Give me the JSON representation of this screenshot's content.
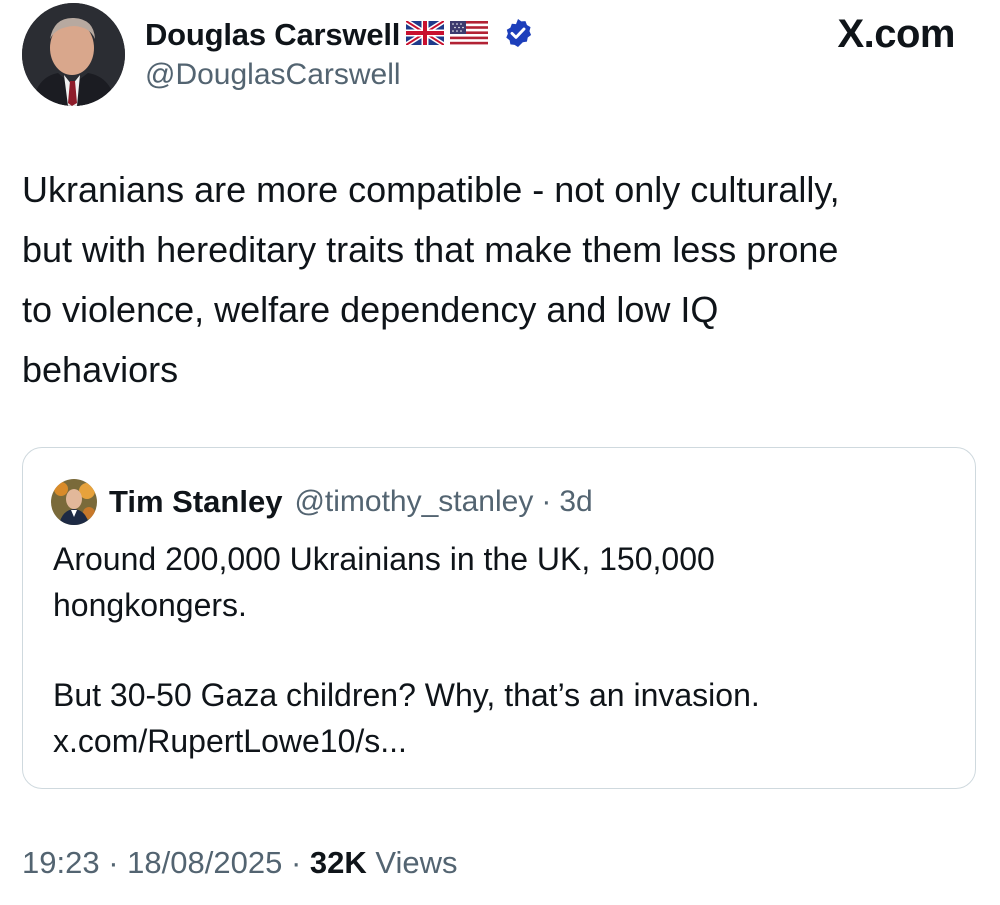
{
  "author": {
    "name": "Douglas Carswell",
    "handle": "@DouglasCarswell",
    "flags": [
      "uk-flag-icon",
      "us-flag-icon"
    ],
    "verified": true
  },
  "brand": "X.com",
  "tweet": {
    "lines": [
      "Ukranians are more compatible - not only culturally,",
      "but with hereditary traits that make them less prone",
      "to violence, welfare dependency and low IQ",
      "behaviors"
    ]
  },
  "quote": {
    "name": "Tim Stanley",
    "handle": "@timothy_stanley",
    "separator": "·",
    "time": "3d",
    "paragraph1": [
      "Around 200,000 Ukrainians in the UK, 150,000",
      "hongkongers."
    ],
    "paragraph2": [
      "But 30-50 Gaza children? Why, that’s an invasion.",
      "x.com/RupertLowe10/s..."
    ]
  },
  "meta": {
    "time": "19:23",
    "sep1": "·",
    "date": "18/08/2025",
    "sep2": "·",
    "views_count": "32K",
    "views_label": "Views"
  },
  "colors": {
    "text": "#0f1419",
    "muted": "#536471",
    "border": "#cfd9de",
    "verified": "#1d3fbb"
  }
}
